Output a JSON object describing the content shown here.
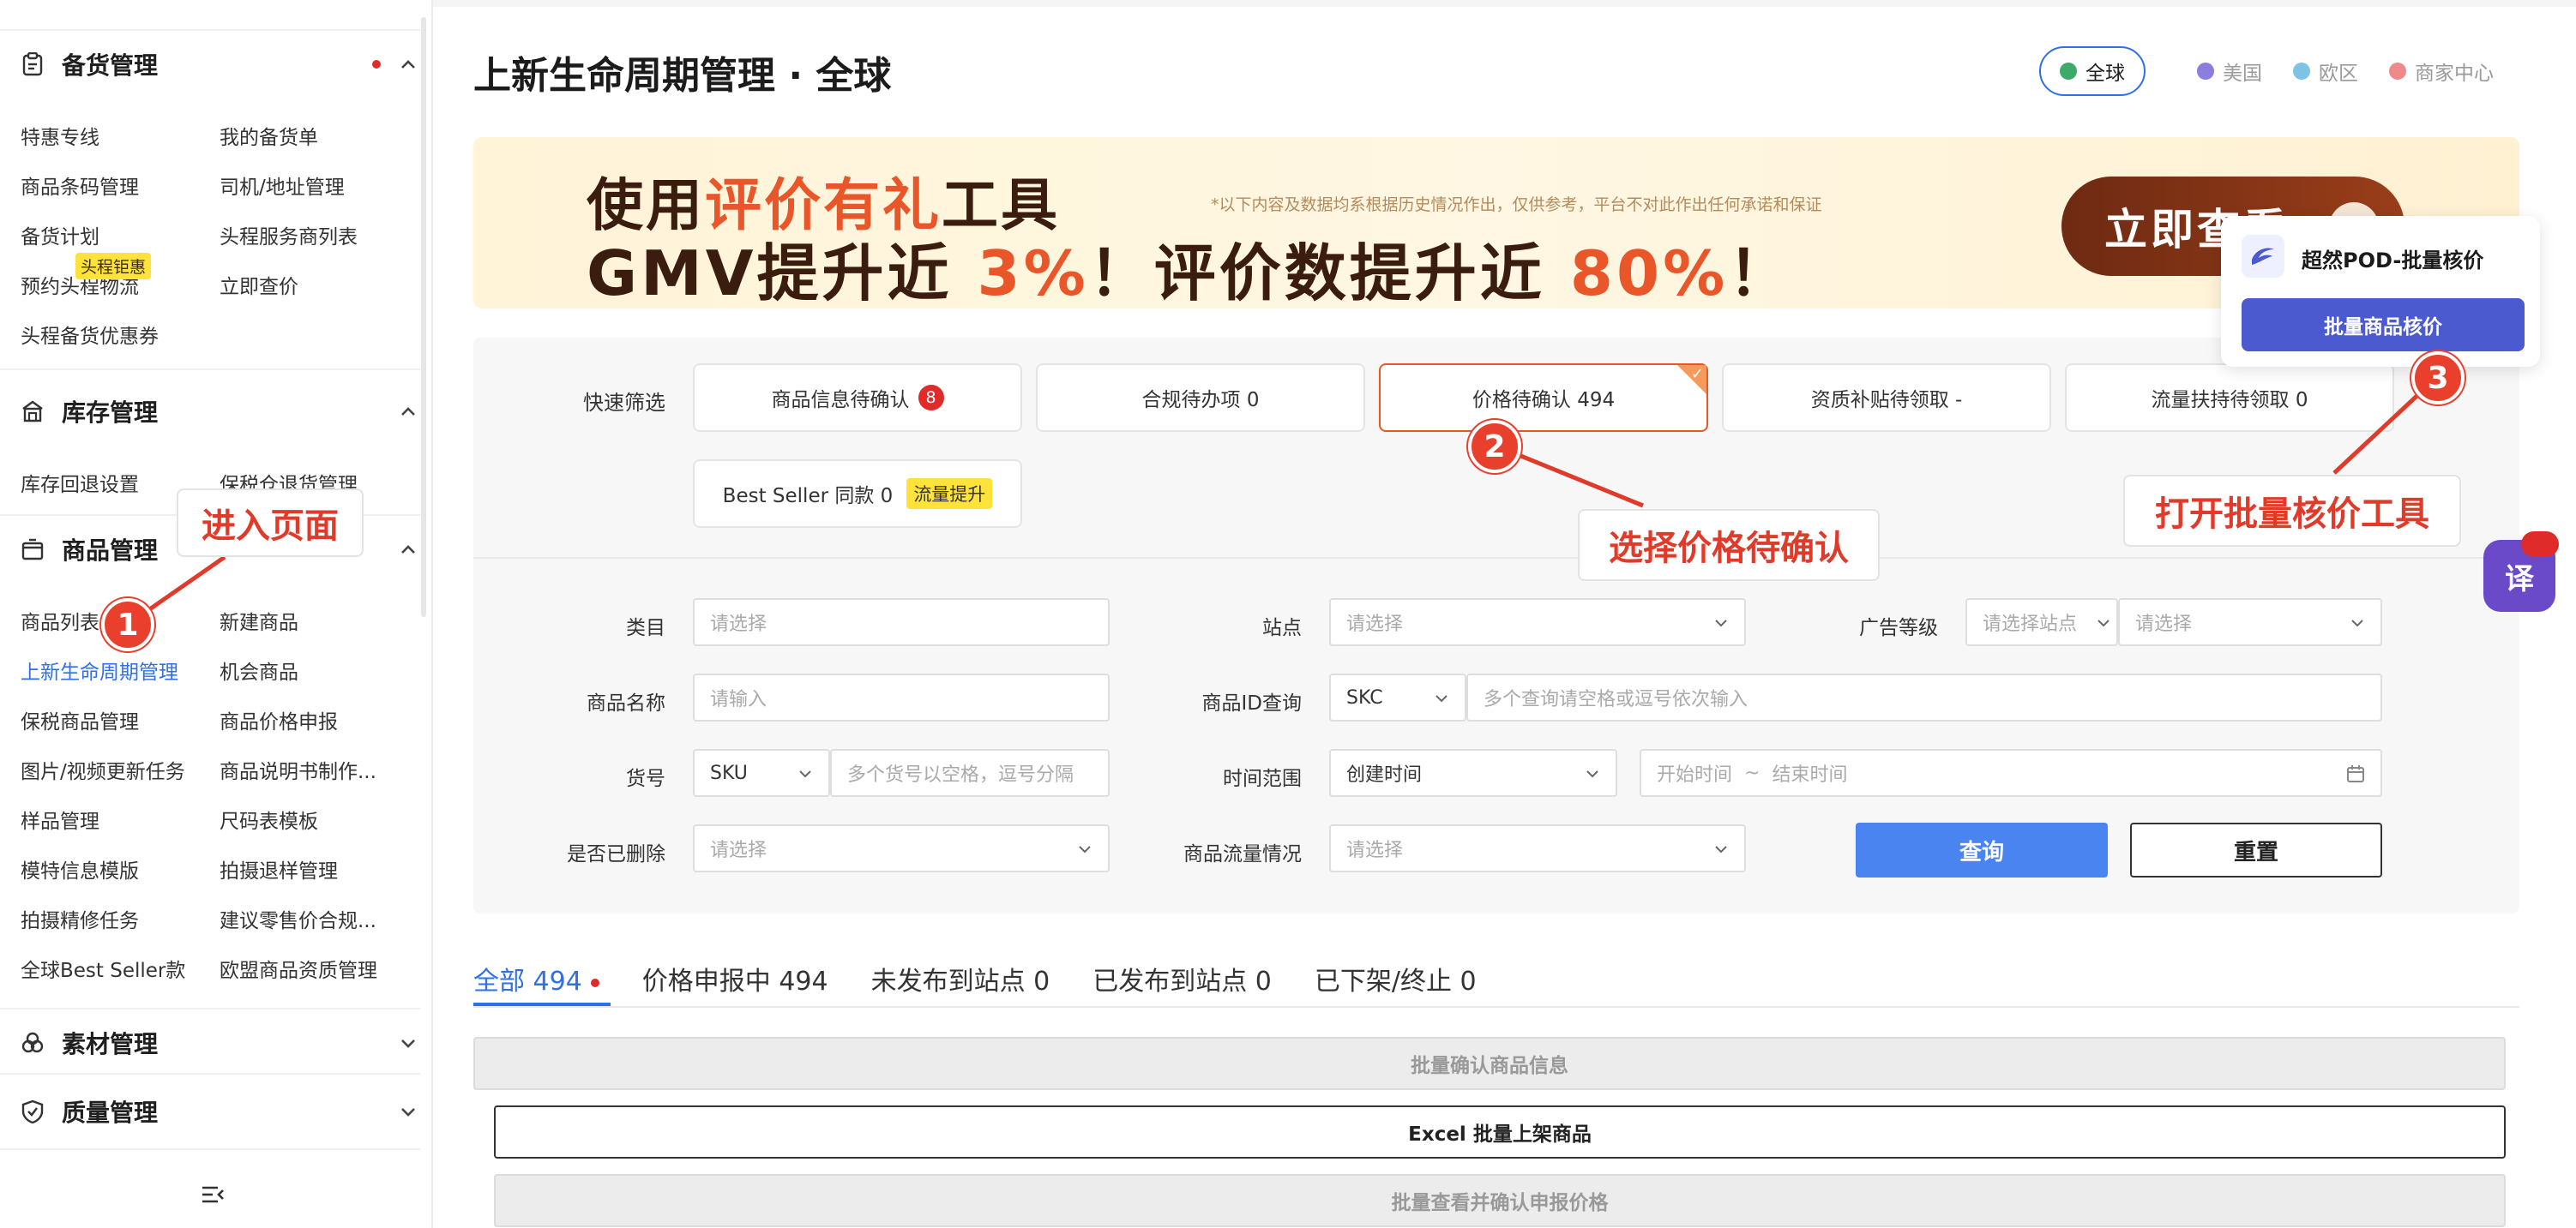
{
  "sidebar": {
    "sections": [
      {
        "title": "备货管理",
        "icon": "clipboard-icon"
      },
      {
        "title": "库存管理",
        "icon": "warehouse-icon"
      },
      {
        "title": "商品管理",
        "icon": "box-icon"
      },
      {
        "title": "素材管理",
        "icon": "material-icon"
      },
      {
        "title": "质量管理",
        "icon": "shield-check-icon"
      }
    ],
    "stock_items": [
      "特惠专线",
      "我的备货单",
      "商品条码管理",
      "司机/地址管理",
      "备货计划",
      "头程服务商列表",
      "预约头程物流",
      "立即查价",
      "头程备货优惠券"
    ],
    "stock_tag": "头程钜惠",
    "inventory_items": [
      "库存回退设置",
      "保税仓退货管理"
    ],
    "product_items": [
      "商品列表",
      "新建商品",
      "上新生命周期管理",
      "机会商品",
      "保税商品管理",
      "商品价格申报",
      "图片/视频更新任务",
      "商品说明书制作...",
      "样品管理",
      "尺码表模板",
      "模特信息模版",
      "拍摄退样管理",
      "拍摄精修任务",
      "建议零售价合规...",
      "全球Best Seller款",
      "欧盟商品资质管理"
    ]
  },
  "header": {
    "title": "上新生命周期管理 · 全球",
    "regions": [
      {
        "label": "全球",
        "color": "#3cab6a"
      },
      {
        "label": "美国",
        "color": "#8a7ee0"
      },
      {
        "label": "欧区",
        "color": "#7cc3e6"
      },
      {
        "label": "商家中心",
        "color": "#f08a8a"
      }
    ]
  },
  "banner": {
    "line1_a": "使用",
    "line1_b": "评价有礼",
    "line1_c": "工具",
    "line2_a": "GMV提升近 ",
    "line2_b": "3%",
    "line2_c": "！评价数提升近 ",
    "line2_d": "80%",
    "line2_e": "！",
    "note": "*以下内容及数据均系根据历史情况作出，仅供参考，平台不对此作出任何承诺和保证",
    "cta": "立即查看"
  },
  "quick_filter": {
    "label": "快速筛选",
    "cards": [
      {
        "label": "商品信息待确认",
        "badge": "8"
      },
      {
        "label": "合规待办项  0"
      },
      {
        "label": "价格待确认  494"
      },
      {
        "label": "资质补贴待领取  -"
      },
      {
        "label": "流量扶持待领取  0"
      },
      {
        "label": "Best Seller 同款  0",
        "tag": "流量提升"
      }
    ]
  },
  "filters": {
    "category": {
      "label": "类目",
      "placeholder": "请选择"
    },
    "site": {
      "label": "站点",
      "placeholder": "请选择"
    },
    "ad_level": {
      "label": "广告等级",
      "site_placeholder": "请选择站点",
      "placeholder": "请选择"
    },
    "name": {
      "label": "商品名称",
      "placeholder": "请输入"
    },
    "id_query": {
      "label": "商品ID查询",
      "type": "SKC",
      "placeholder": "多个查询请空格或逗号依次输入"
    },
    "sku": {
      "label": "货号",
      "type": "SKU",
      "placeholder": "多个货号以空格，逗号分隔"
    },
    "time": {
      "label": "时间范围",
      "type": "创建时间",
      "start": "开始时间",
      "sep": "~",
      "end": "结束时间"
    },
    "deleted": {
      "label": "是否已删除",
      "placeholder": "请选择"
    },
    "traffic": {
      "label": "商品流量情况",
      "placeholder": "请选择"
    },
    "query_btn": "查询",
    "reset_btn": "重置"
  },
  "tabs": [
    {
      "label": "全部 494"
    },
    {
      "label": "价格申报中 494"
    },
    {
      "label": "未发布到站点 0"
    },
    {
      "label": "已发布到站点 0"
    },
    {
      "label": "已下架/终止 0"
    }
  ],
  "bulk_actions": [
    "批量确认商品信息",
    "Excel 批量上架商品",
    "批量查看并确认申报价格"
  ],
  "pod_popup": {
    "title": "超然POD-批量核价",
    "button": "批量商品核价"
  },
  "translate_label": "译",
  "annotations": [
    {
      "num": "1",
      "text": "进入页面"
    },
    {
      "num": "2",
      "text": "选择价格待确认"
    },
    {
      "num": "3",
      "text": "打开批量核价工具"
    }
  ]
}
